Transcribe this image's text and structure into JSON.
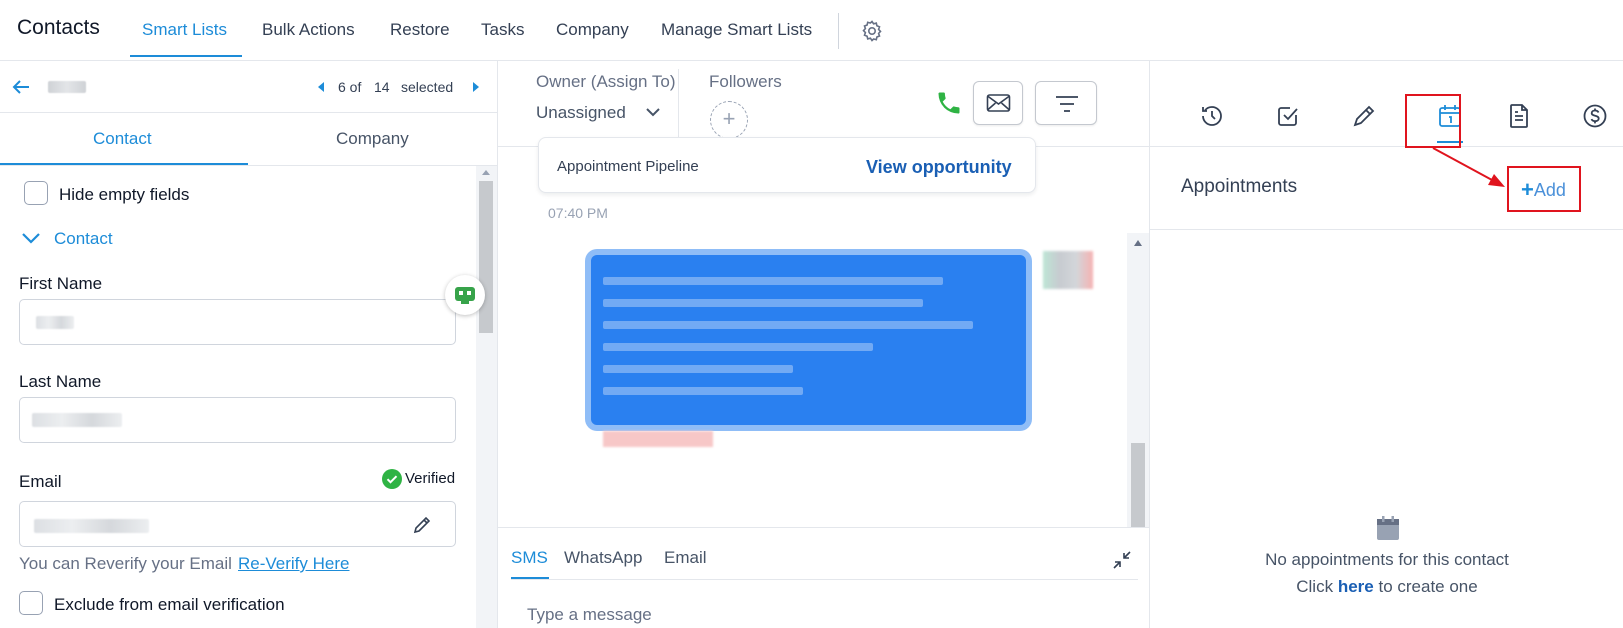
{
  "topnav": {
    "brand": "Contacts",
    "tabs": [
      "Smart Lists",
      "Bulk Actions",
      "Restore",
      "Tasks",
      "Company",
      "Manage Smart Lists"
    ],
    "active_tab": "Smart Lists"
  },
  "left": {
    "pager": {
      "current": "6 of",
      "total": "14",
      "suffix": "selected"
    },
    "subtabs": [
      "Contact",
      "Company"
    ],
    "hide_empty_label": "Hide empty fields",
    "section_label": "Contact",
    "first_name_label": "First Name",
    "last_name_label": "Last Name",
    "email_label": "Email",
    "verified_label": "Verified",
    "reverify_text": "You can Reverify your Email",
    "reverify_link": "Re-Verify Here",
    "exclude_label": "Exclude from email verification"
  },
  "middle": {
    "owner_label": "Owner (Assign To)",
    "owner_value": "Unassigned",
    "followers_label": "Followers",
    "followers_add": "+",
    "opportunity": {
      "pipeline": "Appointment Pipeline",
      "view_link": "View opportunity"
    },
    "timestamp": "07:40 PM",
    "channels": [
      "SMS",
      "WhatsApp",
      "Email"
    ],
    "active_channel": "SMS",
    "message_placeholder": "Type a message"
  },
  "right": {
    "icons": [
      "activity-icon",
      "task-check-icon",
      "pen-icon",
      "calendar-icon",
      "document-icon",
      "dollar-icon"
    ],
    "active_icon": "calendar-icon",
    "section_title": "Appointments",
    "add_label": "Add",
    "empty_line1": "No appointments for this contact",
    "empty_line2_pre": "Click",
    "empty_line2_link": "here",
    "empty_line2_post": "to create one"
  },
  "colors": {
    "accent": "#1d8cd8",
    "annotation": "#e0141e",
    "bubble": "#2a80f0",
    "phone_green": "#2fb344"
  }
}
